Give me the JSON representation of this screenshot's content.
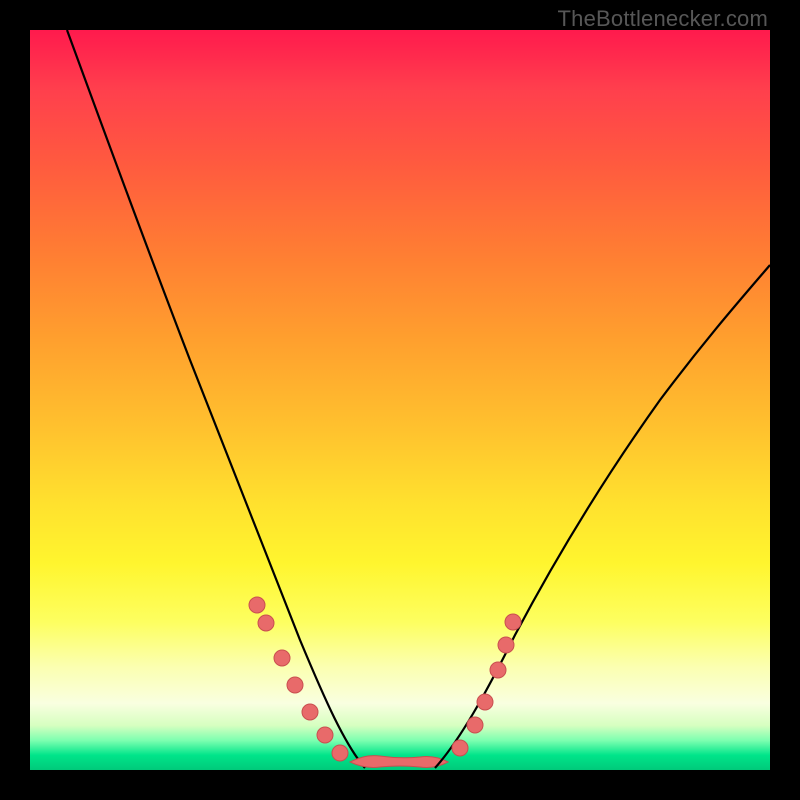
{
  "watermark": "TheBottlenecker.com",
  "colors": {
    "frame": "#000000",
    "gradient_top": "#ff1a4d",
    "gradient_bottom": "#00c97a",
    "curve": "#000000",
    "dots": "#e86a6a"
  },
  "chart_data": {
    "type": "line",
    "title": "",
    "xlabel": "",
    "ylabel": "",
    "xlim": [
      0,
      100
    ],
    "ylim": [
      0,
      100
    ],
    "grid": false,
    "legend": "none",
    "annotations": [
      "TheBottlenecker.com"
    ],
    "curve_left": {
      "x": [
        5,
        8,
        12,
        16,
        20,
        24,
        28,
        32,
        34,
        36,
        38,
        40,
        42,
        44,
        45
      ],
      "y": [
        100,
        92,
        81,
        70,
        59,
        48,
        38,
        28,
        23,
        18,
        13,
        9,
        5,
        2,
        0
      ]
    },
    "curve_right": {
      "x": [
        55,
        57,
        60,
        63,
        66,
        70,
        75,
        80,
        85,
        90,
        95,
        100
      ],
      "y": [
        0,
        3,
        8,
        13,
        18,
        24,
        31,
        38,
        44,
        50,
        55,
        60
      ]
    },
    "valley_flat": {
      "x": [
        45,
        55
      ],
      "y": [
        0,
        0
      ]
    },
    "dots": [
      {
        "x": 30,
        "y": 22
      },
      {
        "x": 31,
        "y": 20
      },
      {
        "x": 33,
        "y": 16
      },
      {
        "x": 35,
        "y": 12
      },
      {
        "x": 37,
        "y": 9
      },
      {
        "x": 39,
        "y": 6
      },
      {
        "x": 41,
        "y": 3
      },
      {
        "x": 58,
        "y": 4
      },
      {
        "x": 60,
        "y": 8
      },
      {
        "x": 61,
        "y": 11
      },
      {
        "x": 63,
        "y": 16
      },
      {
        "x": 64,
        "y": 19
      },
      {
        "x": 65,
        "y": 22
      }
    ]
  }
}
